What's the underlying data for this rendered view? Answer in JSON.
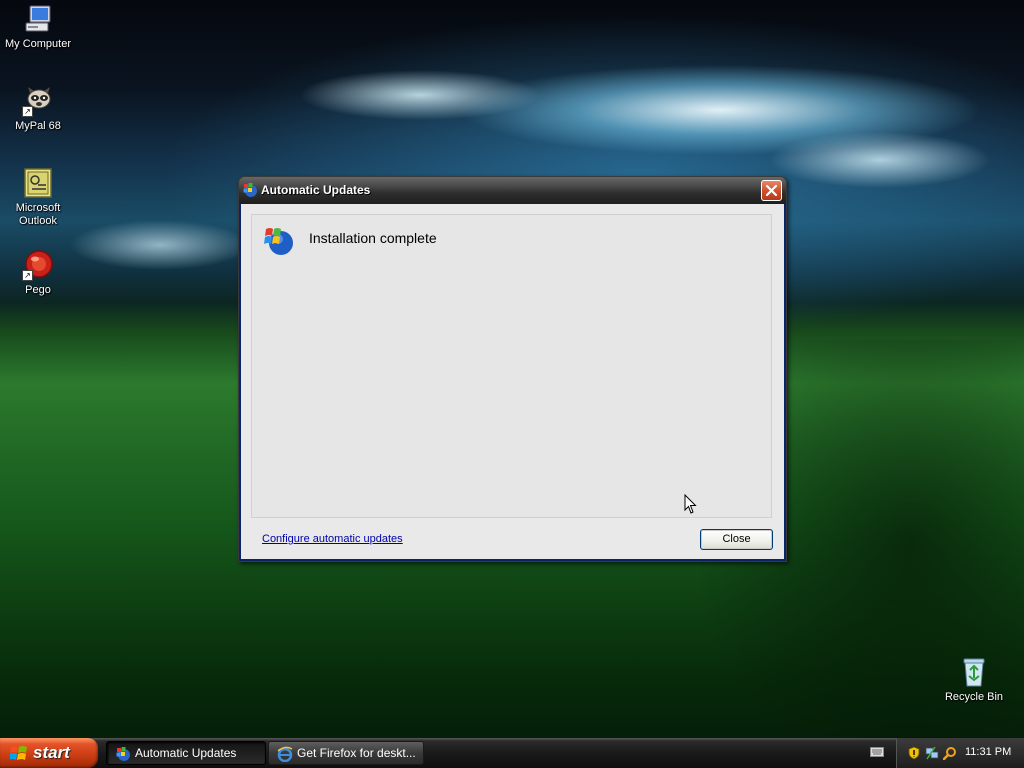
{
  "desktop": {
    "icons": [
      {
        "label": "My Computer",
        "icon": "my-computer-icon"
      },
      {
        "label": "MyPal 68",
        "icon": "mypal-icon"
      },
      {
        "label": "Microsoft Outlook",
        "icon": "outlook-icon"
      },
      {
        "label": "Pego",
        "icon": "pego-icon"
      },
      {
        "label": "Recycle Bin",
        "icon": "recycle-bin-icon"
      }
    ]
  },
  "dialog": {
    "title": "Automatic Updates",
    "title_icon": "windows-update-icon",
    "status": "Installation complete",
    "status_icon": "windows-update-icon",
    "configure_link": "Configure automatic updates",
    "close_label": "Close"
  },
  "taskbar": {
    "start_label": "start",
    "tasks": [
      {
        "label": "Automatic Updates",
        "icon": "windows-update-icon",
        "active": true
      },
      {
        "label": "Get Firefox for deskt...",
        "icon": "internet-explorer-icon",
        "active": false
      }
    ],
    "tray_icons": [
      "keyboard-icon",
      "security-shield-icon",
      "network-icon",
      "search-icon"
    ],
    "clock": "11:31 PM"
  },
  "colors": {
    "titlebar": "#2f2f2f",
    "close_x": "#d2522e",
    "start_button": "#e4532a",
    "link": "#0000aa",
    "dialog_bg": "#e9e9e9"
  }
}
